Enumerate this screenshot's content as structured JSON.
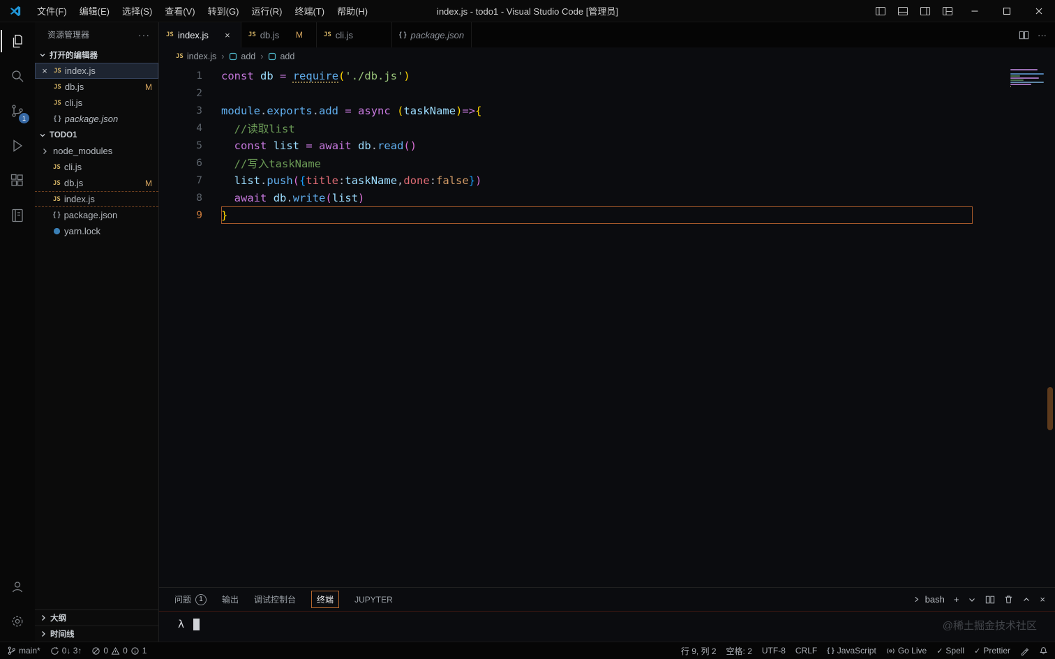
{
  "window": {
    "title": "index.js - todo1 - Visual Studio Code [管理员]",
    "menus": [
      "文件(F)",
      "编辑(E)",
      "选择(S)",
      "查看(V)",
      "转到(G)",
      "运行(R)",
      "终端(T)",
      "帮助(H)"
    ]
  },
  "activity_bar": {
    "scm_badge": "1"
  },
  "sidebar": {
    "title": "资源管理器",
    "open_editors": {
      "label": "打开的编辑器",
      "items": [
        {
          "name": "index.js"
        },
        {
          "name": "db.js",
          "badge": "M"
        },
        {
          "name": "cli.js"
        },
        {
          "name": "package.json"
        }
      ]
    },
    "folder": {
      "label": "TODO1",
      "items": [
        {
          "name": "node_modules"
        },
        {
          "name": "cli.js"
        },
        {
          "name": "db.js",
          "badge": "M"
        },
        {
          "name": "index.js"
        },
        {
          "name": "package.json"
        },
        {
          "name": "yarn.lock"
        }
      ]
    },
    "outline_label": "大纲",
    "timeline_label": "时间线"
  },
  "tabs": [
    {
      "label": "index.js"
    },
    {
      "label": "db.js",
      "badge": "M"
    },
    {
      "label": "cli.js"
    },
    {
      "label": "package.json"
    }
  ],
  "breadcrumbs": [
    {
      "label": "index.js"
    },
    {
      "label": "add"
    },
    {
      "label": "add"
    }
  ],
  "editor": {
    "active_line": 9,
    "lines": [
      {
        "n": "1",
        "tokens": [
          [
            "k",
            "const"
          ],
          [
            "pl",
            " "
          ],
          [
            "v",
            "db"
          ],
          [
            "pl",
            " "
          ],
          [
            "o",
            "="
          ],
          [
            "pl",
            " "
          ],
          [
            "fnu",
            "require"
          ],
          [
            "b1",
            "("
          ],
          [
            "s",
            "'./db.js'"
          ],
          [
            "b1",
            ")"
          ]
        ]
      },
      {
        "n": "2",
        "tokens": []
      },
      {
        "n": "3",
        "tokens": [
          [
            "fn",
            "module"
          ],
          [
            "p",
            "."
          ],
          [
            "fn",
            "exports"
          ],
          [
            "p",
            "."
          ],
          [
            "fn",
            "add"
          ],
          [
            "pl",
            " "
          ],
          [
            "o",
            "="
          ],
          [
            "pl",
            " "
          ],
          [
            "k",
            "async"
          ],
          [
            "pl",
            " "
          ],
          [
            "b1",
            "("
          ],
          [
            "v",
            "taskName"
          ],
          [
            "b1",
            ")"
          ],
          [
            "o",
            "=>"
          ],
          [
            "b1",
            "{"
          ]
        ]
      },
      {
        "n": "4",
        "tokens": [
          [
            "pl",
            "  "
          ],
          [
            "c",
            "//读取list"
          ]
        ]
      },
      {
        "n": "5",
        "tokens": [
          [
            "pl",
            "  "
          ],
          [
            "k",
            "const"
          ],
          [
            "pl",
            " "
          ],
          [
            "v",
            "list"
          ],
          [
            "pl",
            " "
          ],
          [
            "o",
            "="
          ],
          [
            "pl",
            " "
          ],
          [
            "k",
            "await"
          ],
          [
            "pl",
            " "
          ],
          [
            "v",
            "db"
          ],
          [
            "p",
            "."
          ],
          [
            "fn",
            "read"
          ],
          [
            "b2",
            "("
          ],
          [
            "b2",
            ")"
          ]
        ]
      },
      {
        "n": "6",
        "tokens": [
          [
            "pl",
            "  "
          ],
          [
            "c",
            "//写入taskName"
          ]
        ]
      },
      {
        "n": "7",
        "tokens": [
          [
            "pl",
            "  "
          ],
          [
            "v",
            "list"
          ],
          [
            "p",
            "."
          ],
          [
            "fn",
            "push"
          ],
          [
            "b2",
            "("
          ],
          [
            "b3",
            "{"
          ],
          [
            "key",
            "title"
          ],
          [
            "p",
            ":"
          ],
          [
            "v",
            "taskName"
          ],
          [
            "p",
            ","
          ],
          [
            "key",
            "done"
          ],
          [
            "p",
            ":"
          ],
          [
            "bool",
            "false"
          ],
          [
            "b3",
            "}"
          ],
          [
            "b2",
            ")"
          ]
        ]
      },
      {
        "n": "8",
        "tokens": [
          [
            "pl",
            "  "
          ],
          [
            "k",
            "await"
          ],
          [
            "pl",
            " "
          ],
          [
            "v",
            "db"
          ],
          [
            "p",
            "."
          ],
          [
            "fn",
            "write"
          ],
          [
            "b2",
            "("
          ],
          [
            "v",
            "list"
          ],
          [
            "b2",
            ")"
          ]
        ]
      },
      {
        "n": "9",
        "active": true,
        "tokens": [
          [
            "b1",
            "}"
          ]
        ]
      }
    ]
  },
  "panel": {
    "tabs": [
      {
        "label": "问题",
        "badge": "1"
      },
      {
        "label": "输出"
      },
      {
        "label": "调试控制台"
      },
      {
        "label": "终端"
      },
      {
        "label": "JUPYTER"
      }
    ],
    "shell": "bash",
    "prompt": "λ",
    "watermark": "@稀土掘金技术社区"
  },
  "status": {
    "branch": "main*",
    "sync": "0↓ 3↑",
    "errors": "0",
    "warnings": "0",
    "info": "1",
    "line_col": "行 9, 列 2",
    "indent": "空格: 2",
    "encoding": "UTF-8",
    "eol": "CRLF",
    "language": "JavaScript",
    "go_live": "Go Live",
    "spell": "Spell",
    "prettier": "Prettier"
  },
  "colors": {
    "accent_orange": "#b4662c",
    "modified_badge": "#d7a65f",
    "scm_badge_bg": "#3668a4",
    "js_icon": "#d6b566",
    "string": "#98c379",
    "keyword": "#c678dd",
    "comment": "#6a9955"
  }
}
